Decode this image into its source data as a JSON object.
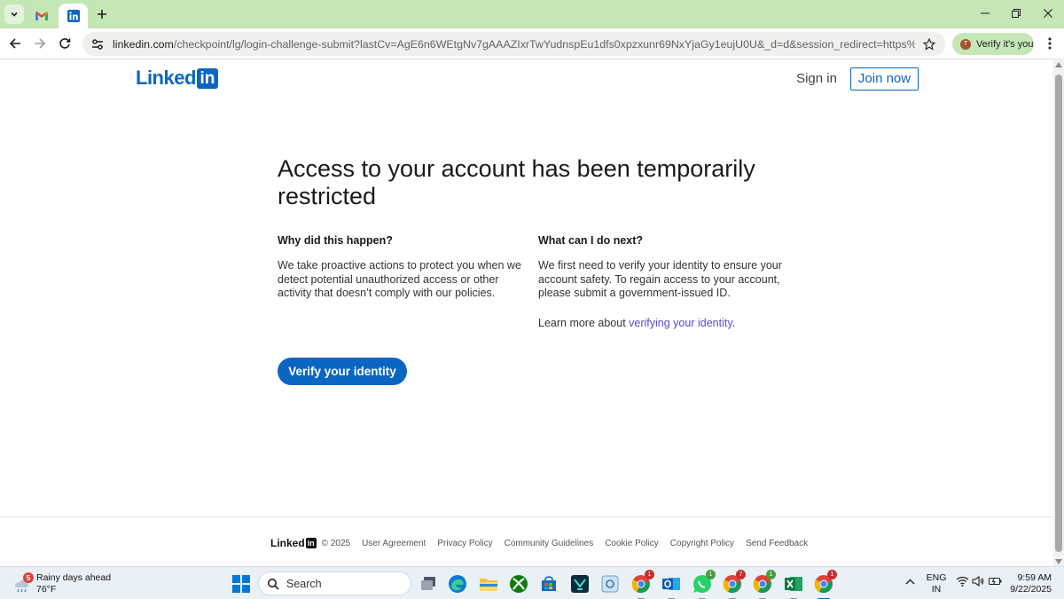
{
  "browser": {
    "url_host": "linkedin.com",
    "url_path": "/checkpoint/lg/login-challenge-submit?lastCv=AgE6n6WEtgNv7gAAAZIxrTwYudnspEu1dfs0xpzxunr69NxYjaGy1eujU0U&_d=d&session_redirect=https%3A%2F%2Fwww%2Eli...",
    "profile_chip": "Verify it's you",
    "profile_initial": "T"
  },
  "header": {
    "logo_text": "Linked",
    "logo_box": "in",
    "signin_label": "Sign in",
    "joinnow_label": "Join now"
  },
  "main": {
    "title": "Access to your account has been temporarily restricted",
    "left_heading": "Why did this happen?",
    "left_body": "We take proactive actions to protect you when we detect potential unauthorized access or other activity that doesn’t comply with our policies.",
    "right_heading": "What can I do next?",
    "right_body": "We first need to verify your identity to ensure your account safety. To regain access to your account, please submit a government-issued ID.",
    "learn_prefix": "Learn more about ",
    "learn_link": "verifying your identity",
    "learn_suffix": ".",
    "verify_button": "Verify your identity"
  },
  "footer": {
    "logo_text": "Linked",
    "logo_box": "in",
    "copyright": "© 2025",
    "links": [
      "User Agreement",
      "Privacy Policy",
      "Community Guidelines",
      "Cookie Policy",
      "Copyright Policy",
      "Send Feedback"
    ]
  },
  "taskbar": {
    "weather_badge": "5",
    "weather_title": "Rainy days ahead",
    "weather_temp": "76°F",
    "search_label": "Search",
    "lang_1": "ENG",
    "lang_2": "IN",
    "time": "9:59 AM",
    "date": "9/22/2025",
    "badges": {
      "chrome_1": "1",
      "whatsapp": "1",
      "chrome_2": "7",
      "chrome_3": "1",
      "chrome_4": "1"
    }
  },
  "colors": {
    "linkedin_blue": "#0a66c2",
    "link_purple": "#5749d4",
    "tabstrip_green": "#c5e6b5"
  }
}
